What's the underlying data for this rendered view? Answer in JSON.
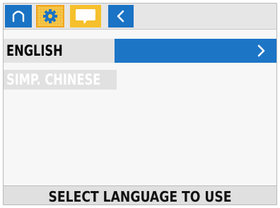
{
  "toolbar": {
    "icons": [
      "home-icon",
      "gear-icon",
      "chat-bubble-icon",
      "back-chevron-icon"
    ],
    "colors": {
      "blue": "#1a73c4",
      "yellow": "#f5c02c"
    }
  },
  "languages": {
    "items": [
      {
        "label": "ENGLISH",
        "selected": true
      },
      {
        "label": "SIMP. CHINESE",
        "selected": false
      }
    ],
    "accent": "#1d75c6"
  },
  "footer": {
    "text": "SELECT LANGUAGE TO USE"
  }
}
